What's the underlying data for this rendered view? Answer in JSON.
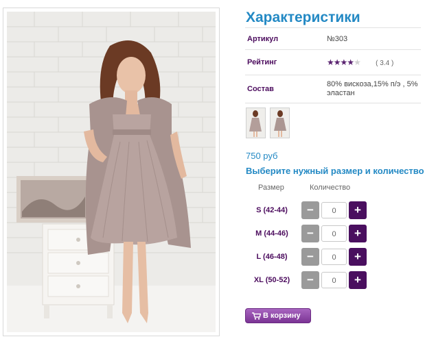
{
  "product": {
    "image_alt": "dress photo"
  },
  "specs": {
    "title": "Характеристики",
    "rows": [
      {
        "key": "Артикул",
        "value": "№303"
      },
      {
        "key": "Рейтинг",
        "value": "( 3.4 )",
        "stars_filled": 3.4,
        "stars_total": 5
      },
      {
        "key": "Состав",
        "value_line1": "80% вискоза,15% п/э , 5%",
        "value_line2": "эластан"
      }
    ]
  },
  "price": "750 руб",
  "size_prompt": "Выберите нужный размер и количество",
  "size_table": {
    "col_size": "Размер",
    "col_qty": "Количество",
    "minus_label": "−",
    "plus_label": "+",
    "rows": [
      {
        "size": "S (42-44)",
        "qty": "0"
      },
      {
        "size": "M (44-46)",
        "qty": "0"
      },
      {
        "size": "L (46-48)",
        "qty": "0"
      },
      {
        "size": "XL (50-52)",
        "qty": "0"
      }
    ]
  },
  "cart_button": "В корзину",
  "colors": {
    "accent_blue": "#2389c4",
    "accent_purple": "#4a0f5f"
  }
}
